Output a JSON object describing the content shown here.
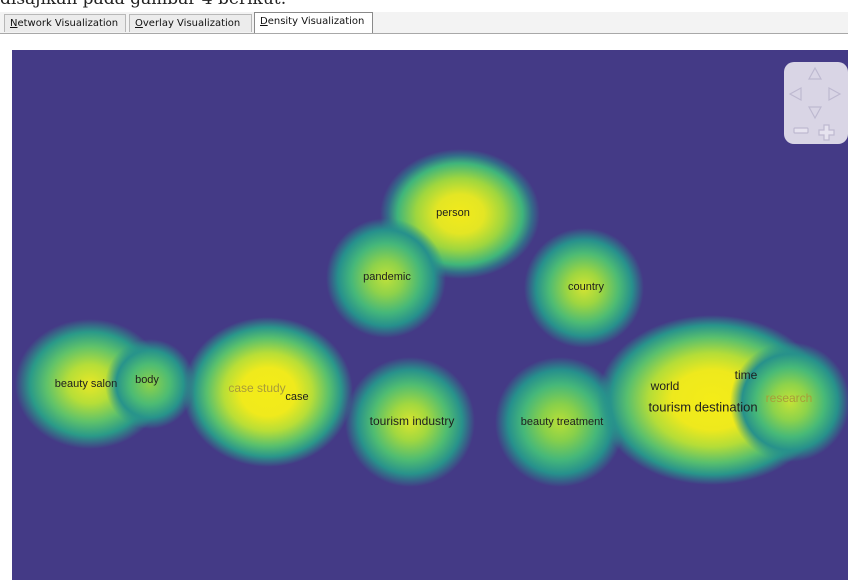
{
  "doc_text": "disajikan pada gambar 4 berikut:",
  "tabs": [
    {
      "pre": "",
      "mn": "N",
      "post": "etwork Visualization",
      "active": false
    },
    {
      "pre": "",
      "mn": "O",
      "post": "verlay Visualization",
      "active": false
    },
    {
      "pre": "",
      "mn": "D",
      "post": "ensity Visualization",
      "active": true
    }
  ],
  "terms": {
    "person": "person",
    "pandemic": "pandemic",
    "country": "country",
    "beauty_salon": "beauty salon",
    "body": "body",
    "case_study": "case study",
    "case": "case",
    "tourism_industry": "tourism industry",
    "beauty_treatment": "beauty treatment",
    "world": "world",
    "time": "time",
    "tourism_destination": "tourism destination",
    "research": "research"
  },
  "colors": {
    "background": "#443a86",
    "low": "#26a98a",
    "mid": "#7ed04b",
    "high": "#f2ea1b"
  },
  "nav_icons": [
    "arrow-up-icon",
    "arrow-left-icon",
    "arrow-right-icon",
    "arrow-down-icon",
    "zoom-out-icon",
    "zoom-in-icon"
  ]
}
